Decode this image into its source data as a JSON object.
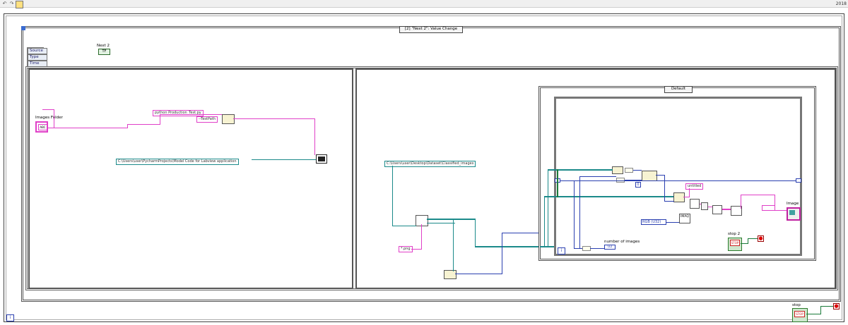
{
  "toolbar": {
    "number": "2018"
  },
  "event": {
    "case_label": "[2] \"Next 2\": Value Change",
    "data_items": [
      "Source",
      "Type",
      "Time"
    ]
  },
  "controls": {
    "next2_label": "Next 2",
    "next2_value": "TF",
    "stop_label": "stop",
    "stop2_label": "stop 2",
    "stop_btn_text": "STOP"
  },
  "left_frame": {
    "images_folder_label": "Images Folder",
    "script_const": "python Production_Test.py",
    "testpath_const": "--TestPath",
    "dir_const": "C:\\Users\\user\\PycharmProjects\\Model Code for Labview application"
  },
  "right_frame": {
    "dataset_path": "C:\\Users\\user\\Desktop\\Dataset\\Classified_images",
    "png_const": "*.png",
    "case_default": "Default",
    "untitled_const": "untitled",
    "image_label": "Image",
    "rgb_selector": "RGB (U32)",
    "number_of_images_label": "number of images",
    "number_of_images_indicator": "I32",
    "imaq_label": "IMAQ",
    "index_const": "0"
  }
}
